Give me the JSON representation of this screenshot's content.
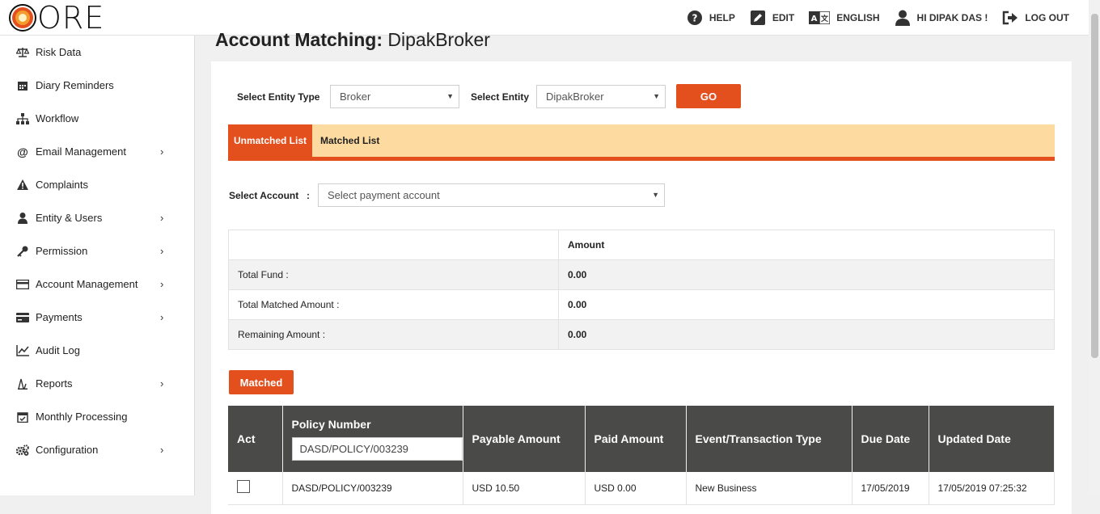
{
  "app": {
    "logo_text": "ORE"
  },
  "topnav": [
    {
      "icon": "help-icon",
      "label": "HELP"
    },
    {
      "icon": "edit-icon",
      "label": "EDIT"
    },
    {
      "icon": "translate-icon",
      "label": "ENGLISH"
    },
    {
      "icon": "user-icon",
      "label": "HI DIPAK DAS !"
    },
    {
      "icon": "logout-icon",
      "label": "LOG OUT"
    }
  ],
  "sidebar": {
    "items": [
      {
        "icon": "scale-icon",
        "label": "Risk Data",
        "has_submenu": false
      },
      {
        "icon": "calendar-icon",
        "label": "Diary Reminders",
        "has_submenu": false
      },
      {
        "icon": "sitemap-icon",
        "label": "Workflow",
        "has_submenu": false
      },
      {
        "icon": "at-icon",
        "label": "Email Management",
        "has_submenu": true
      },
      {
        "icon": "warning-icon",
        "label": "Complaints",
        "has_submenu": false
      },
      {
        "icon": "user-icon",
        "label": "Entity & Users",
        "has_submenu": true
      },
      {
        "icon": "key-icon",
        "label": "Permission",
        "has_submenu": true
      },
      {
        "icon": "card-icon",
        "label": "Account Management",
        "has_submenu": true
      },
      {
        "icon": "credit-card-icon",
        "label": "Payments",
        "has_submenu": true
      },
      {
        "icon": "line-chart-icon",
        "label": "Audit Log",
        "has_submenu": false
      },
      {
        "icon": "report-icon",
        "label": "Reports",
        "has_submenu": true
      },
      {
        "icon": "calendar-check-icon",
        "label": "Monthly Processing",
        "has_submenu": false
      },
      {
        "icon": "cogs-icon",
        "label": "Configuration",
        "has_submenu": true
      }
    ],
    "chevron": "›"
  },
  "page": {
    "title_bold": "Account Matching:",
    "title_rest": "DipakBroker"
  },
  "filters": {
    "entity_type_label": "Select Entity Type",
    "entity_type_value": "Broker",
    "entity_label": "Select Entity",
    "entity_value": "DipakBroker",
    "go_label": "GO"
  },
  "tabs": [
    {
      "label": "Unmatched List",
      "active": true
    },
    {
      "label": "Matched List",
      "active": false
    }
  ],
  "account": {
    "label": "Select Account",
    "colon": ":",
    "placeholder": "Select payment account"
  },
  "summary": {
    "header": "Amount",
    "rows": [
      {
        "label": "Total Fund :",
        "value": "0.00"
      },
      {
        "label": "Total Matched Amount :",
        "value": "0.00"
      },
      {
        "label": "Remaining Amount :",
        "value": "0.00"
      }
    ]
  },
  "matched_button": "Matched",
  "grid": {
    "columns": [
      "Act",
      "Policy Number",
      "Payable Amount",
      "Paid Amount",
      "Event/Transaction Type",
      "Due Date",
      "Updated Date"
    ],
    "policy_filter_value": "DASD/POLICY/003239",
    "rows": [
      {
        "policy": "DASD/POLICY/003239",
        "payable": "USD 10.50",
        "paid": "USD 0.00",
        "event": "New Business",
        "due": "17/05/2019",
        "updated": "17/05/2019 07:25:32"
      }
    ]
  },
  "colors": {
    "accent": "#e3501e",
    "tab_bar": "#fddba0",
    "grid_header": "#4a4a49"
  }
}
